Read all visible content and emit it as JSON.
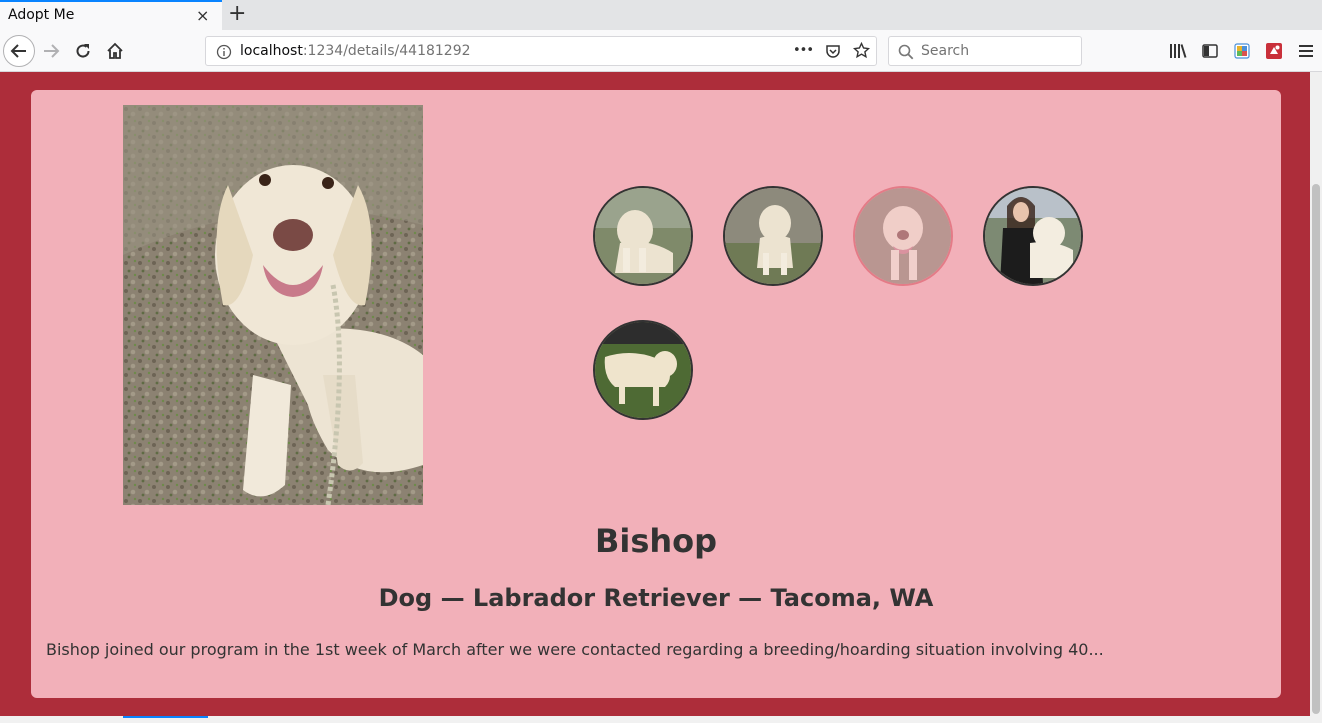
{
  "browser": {
    "tab_title": "Adopt Me",
    "url_host": "localhost",
    "url_path": ":1234/details/44181292",
    "search_placeholder": "Search",
    "close_glyph": "×",
    "newtab_glyph": "+",
    "more_glyph": "•••"
  },
  "pet": {
    "name": "Bishop",
    "meta": "Dog — Labrador Retriever — Tacoma, WA",
    "description": "Bishop joined our program in the 1st week of March after we were contacted regarding a breeding/hoarding situation involving 40...",
    "photo_count": 5,
    "active_photo_index": 2
  },
  "colors": {
    "page_background": "#ad2d3a",
    "card_background": "#f2b0b9",
    "text": "#333333",
    "active_thumb_border": "#d9515f"
  }
}
